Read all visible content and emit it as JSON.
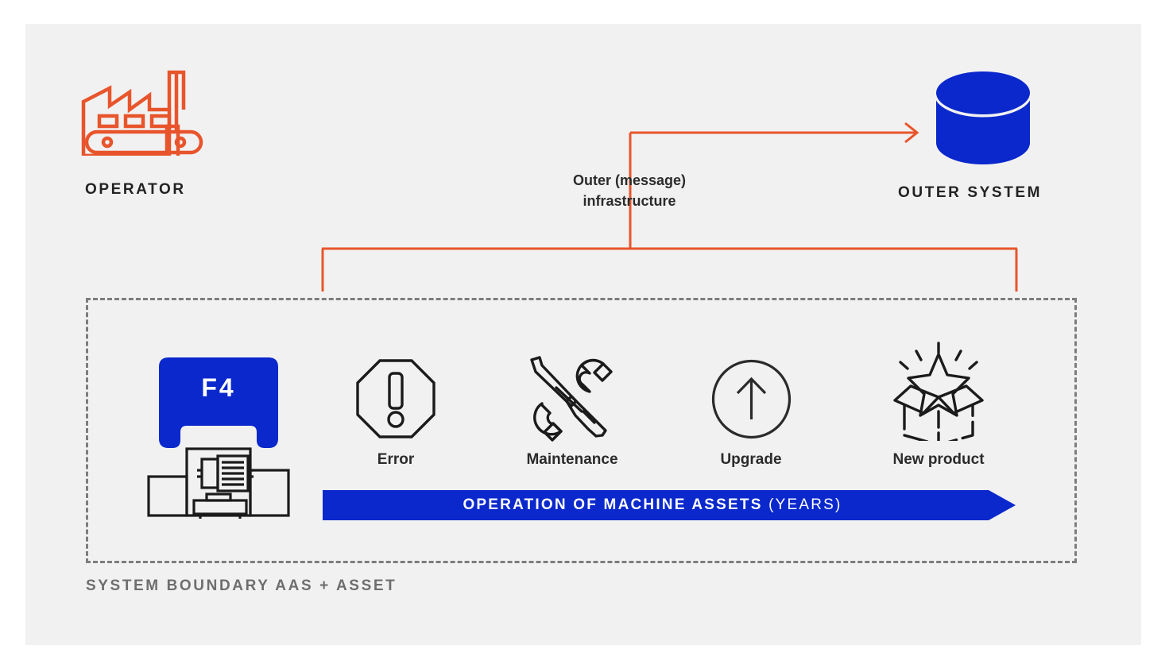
{
  "diagram": {
    "title_hidden": "",
    "colors": {
      "background": "#ffffff",
      "panel": "#f1f1f1",
      "orange": "#e8552c",
      "blue": "#0a28cc",
      "dark_text": "#2b2b2b",
      "gray_dashed": "#7d7d7d",
      "gray_label": "#6e6e6e",
      "icon_stroke": "#1b1b1b"
    },
    "top": {
      "operator_label": "OPERATOR",
      "operator_icon": "factory-icon",
      "outer_system_label": "OUTER SYSTEM",
      "outer_system_icon": "database-cylinder-icon",
      "middle_label_line1": "Outer (message)",
      "middle_label_line2": "infrastructure"
    },
    "boundary": {
      "label": "SYSTEM BOUNDARY AAS + ASSET"
    },
    "machine": {
      "badge_text": "F4",
      "icon": "machine-press-icon"
    },
    "lifecycle_icons": [
      {
        "id": "error",
        "icon": "octagon-exclamation-icon",
        "label": "Error"
      },
      {
        "id": "maintenance",
        "icon": "wrench-screwdriver-icon",
        "label": "Maintenance"
      },
      {
        "id": "upgrade",
        "icon": "circle-arrow-up-icon",
        "label": "Upgrade"
      },
      {
        "id": "new-product",
        "icon": "open-box-star-icon",
        "label": "New product"
      }
    ],
    "operation_bar": {
      "text_strong": "OPERATION OF MACHINE ASSETS",
      "text_light": "(YEARS)"
    }
  }
}
